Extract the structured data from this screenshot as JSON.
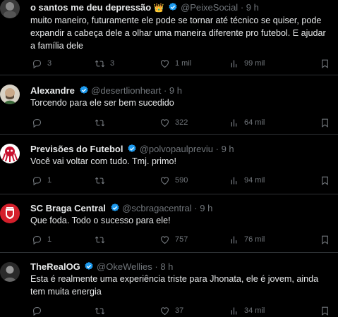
{
  "tweets": [
    {
      "name": "o santos me deu depressão",
      "name_emoji": "👑",
      "handle": "@PeixeSocial",
      "time": "9 h",
      "text": "muito maneiro, futuramente ele pode se tornar até técnico se quiser, pode expandir a cabeça dele a olhar uma maneira diferente pro futebol. E ajudar a família dele",
      "replies": "3",
      "retweets": "3",
      "likes": "1 mil",
      "views": "99 mil",
      "avatar_colors": [
        "#3a3a3a",
        "#777"
      ]
    },
    {
      "name": "Alexandre",
      "handle": "@desertlionheart",
      "time": "9 h",
      "text": "Torcendo para ele ser bem sucedido",
      "replies": "",
      "retweets": "",
      "likes": "322",
      "views": "64 mil",
      "avatar_colors": [
        "#d8d2c6",
        "#3c6a3a"
      ]
    },
    {
      "name": "Previsões do Futebol",
      "handle": "@polvopaulpreviu",
      "time": "9 h",
      "text": "Você vai voltar com tudo. Tmj. primo!",
      "replies": "1",
      "retweets": "",
      "likes": "590",
      "views": "94 mil",
      "avatar_colors": [
        "#ffffff",
        "#c8102e"
      ]
    },
    {
      "name": "SC Braga Central",
      "handle": "@scbragacentral",
      "time": "9 h",
      "text": "Que foda. Todo o sucesso para ele!",
      "replies": "1",
      "retweets": "",
      "likes": "757",
      "views": "76 mil",
      "avatar_colors": [
        "#d41f2b",
        "#ffffff"
      ]
    },
    {
      "name": "TheRealOG",
      "handle": "@OkeWellies",
      "time": "8 h",
      "text": "Esta é realmente uma experiência triste para Jhonata, ele é jovem, ainda tem muita energia",
      "replies": "",
      "retweets": "",
      "likes": "37",
      "views": "34 mil",
      "avatar_colors": [
        "#2a2a2a",
        "#999"
      ]
    }
  ],
  "separator": "·",
  "colors": {
    "background": "#000000",
    "text": "#e7e9ea",
    "muted": "#71767b",
    "verified": "#1d9bf0",
    "border": "#2f3336"
  },
  "icons": [
    "reply-icon",
    "retweet-icon",
    "like-icon",
    "views-icon",
    "bookmark-icon",
    "share-icon",
    "verified-badge-icon"
  ]
}
